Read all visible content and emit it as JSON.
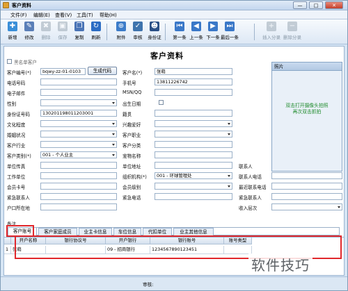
{
  "window": {
    "title": "客户资料",
    "controls": [
      "—",
      "□",
      "✕"
    ]
  },
  "menu": [
    {
      "label": "文件(F)"
    },
    {
      "label": "编辑(E)"
    },
    {
      "label": "查看(V)"
    },
    {
      "label": "工具(T)"
    },
    {
      "label": "帮助(H)"
    }
  ],
  "toolbar": [
    {
      "label": "新增",
      "icon": "new-icon",
      "color": "#3a8fd8",
      "glyph": "✚",
      "enabled": true
    },
    {
      "label": "修改",
      "icon": "edit-icon",
      "color": "#5a7fb8",
      "glyph": "✎",
      "enabled": true
    },
    {
      "label": "删除",
      "icon": "delete-icon",
      "color": "#8a9aa8",
      "glyph": "✖",
      "enabled": false
    },
    {
      "label": "保存",
      "icon": "save-icon",
      "color": "#8a9aa8",
      "glyph": "▣",
      "enabled": false
    },
    {
      "label": "复制",
      "icon": "copy-icon",
      "color": "#4a74b6",
      "glyph": "❐",
      "enabled": true
    },
    {
      "label": "刷新",
      "icon": "refresh-icon",
      "color": "#2b6cc4",
      "glyph": "↻",
      "enabled": true
    },
    {
      "label": "附件",
      "icon": "attachment-icon",
      "color": "#3c7cc9",
      "glyph": "⊕",
      "enabled": true
    },
    {
      "label": "审核",
      "icon": "audit-icon",
      "color": "#3f74ad",
      "glyph": "✓",
      "enabled": true
    },
    {
      "label": "身份证",
      "icon": "id-card-icon",
      "color": "#2a4f86",
      "glyph": "☻",
      "enabled": true
    },
    {
      "label": "第一条",
      "icon": "first-record-icon",
      "color": "#3a78c8",
      "glyph": "⏮",
      "enabled": true
    },
    {
      "label": "上一条",
      "icon": "previous-record-icon",
      "color": "#3a78c8",
      "glyph": "◀",
      "enabled": true
    },
    {
      "label": "下一条",
      "icon": "next-record-icon",
      "color": "#3a78c8",
      "glyph": "▶",
      "enabled": true
    },
    {
      "label": "最后一条",
      "icon": "last-record-icon",
      "color": "#3a78c8",
      "glyph": "⏭",
      "enabled": true
    },
    {
      "label": "插入分录",
      "icon": "insert-entry-icon",
      "color": "#8a9aa8",
      "glyph": "+",
      "enabled": false
    },
    {
      "label": "删除分录",
      "icon": "delete-entry-icon",
      "color": "#8a9aa8",
      "glyph": "−",
      "enabled": false
    }
  ],
  "form": {
    "title": "客户资料",
    "blacklist_label": "黑名单客户",
    "generate_code_button": "生成代码",
    "photo_header": "照片",
    "photo_tip": "双击打开摄像头拍照\n再次双击抓拍",
    "left_fields": [
      {
        "label": "客户编号(*)",
        "value": "bqwy-zz-01-0103"
      },
      {
        "label": "电话号码",
        "value": ""
      },
      {
        "label": "电子邮件",
        "value": ""
      },
      {
        "label": "性别",
        "value": ""
      },
      {
        "label": "身份证号码",
        "value": "130201198011203001"
      },
      {
        "label": "文化程度",
        "value": ""
      },
      {
        "label": "婚姻状况",
        "value": ""
      },
      {
        "label": "客户行业",
        "value": ""
      },
      {
        "label": "客户类别(*)",
        "value": "001 - 个人业主"
      },
      {
        "label": "单位传真",
        "value": ""
      },
      {
        "label": "工作单位",
        "value": ""
      },
      {
        "label": "会员卡号",
        "value": ""
      },
      {
        "label": "紧急联系人",
        "value": ""
      },
      {
        "label": "户口所在地",
        "value": ""
      }
    ],
    "mid_fields": [
      {
        "label": "客户名(*)",
        "value": "张萌"
      },
      {
        "label": "手机号",
        "value": "13811226742"
      },
      {
        "label": "MSN/QQ",
        "value": ""
      },
      {
        "label": "出生日期",
        "value": ""
      },
      {
        "label": "籍贯",
        "value": ""
      },
      {
        "label": "兴趣爱好",
        "value": ""
      },
      {
        "label": "客户职业",
        "value": ""
      },
      {
        "label": "客户分类",
        "value": ""
      },
      {
        "label": "宠物名称",
        "value": ""
      },
      {
        "label": "单位地址",
        "value": ""
      },
      {
        "label": "组织机构(*)",
        "value": "001 - 环球管理处"
      },
      {
        "label": "会员级别",
        "value": ""
      },
      {
        "label": "紧急电话",
        "value": ""
      }
    ],
    "right_fields": [
      {
        "label": "联系人",
        "value": ""
      },
      {
        "label": "联系人电话",
        "value": ""
      },
      {
        "label": "最近联系电话",
        "value": ""
      },
      {
        "label": "紧急联系人",
        "value": ""
      },
      {
        "label": "收入层次",
        "value": ""
      }
    ],
    "remark_label": "备注"
  },
  "tabs": [
    "客户账号",
    "客户家庭成员",
    "业主卡信息",
    "车位信息",
    "代扣单位",
    "业主其他信息"
  ],
  "grid": {
    "columns": [
      "开户名称",
      "银行协议号",
      "开户银行",
      "银行账号",
      "账号类型"
    ],
    "rows": [
      {
        "no": "1",
        "cells": [
          "张萌",
          "",
          "09 - 招商银行",
          "1234567890123451",
          ""
        ]
      }
    ]
  },
  "status": {
    "audit_label": "审核:"
  },
  "watermark": "软件技巧"
}
